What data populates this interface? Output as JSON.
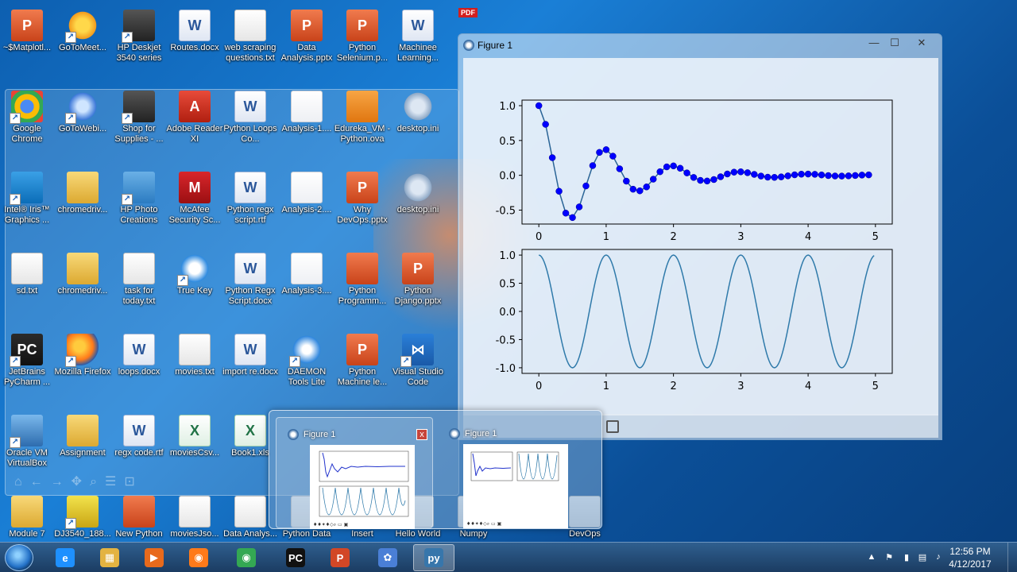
{
  "desktop": {
    "icons": [
      {
        "label": "~$Matplotl...",
        "type": "ppt",
        "glyph": "P"
      },
      {
        "label": "GoToMeet...",
        "type": "flower",
        "glyph": ""
      },
      {
        "label": "HP Deskjet 3540 series",
        "type": "printer",
        "glyph": ""
      },
      {
        "label": "Routes.docx",
        "type": "word",
        "glyph": "W"
      },
      {
        "label": "web scraping questions.txt",
        "type": "txt",
        "glyph": ""
      },
      {
        "label": "Data Analysis.pptx",
        "type": "ppt",
        "glyph": "P"
      },
      {
        "label": "Python Selenium.p...",
        "type": "ppt",
        "glyph": "P"
      },
      {
        "label": "Machinee Learning...",
        "type": "word",
        "glyph": "W"
      },
      {
        "label": "Google Chrome",
        "type": "chrome",
        "glyph": ""
      },
      {
        "label": "GoToWebi...",
        "type": "flower-blue",
        "glyph": ""
      },
      {
        "label": "Shop for Supplies - ...",
        "type": "printer",
        "glyph": ""
      },
      {
        "label": "Adobe Reader XI",
        "type": "pdf",
        "glyph": "A"
      },
      {
        "label": "Python Loops Co...",
        "type": "word",
        "glyph": "W"
      },
      {
        "label": "Analysis-1....",
        "type": "chart",
        "glyph": ""
      },
      {
        "label": "Edureka_VM - Python.ova",
        "type": "ova",
        "glyph": ""
      },
      {
        "label": "desktop.ini",
        "type": "gear",
        "glyph": ""
      },
      {
        "label": "Intel® Iris™ Graphics ...",
        "type": "intel",
        "glyph": ""
      },
      {
        "label": "chromedriv...",
        "type": "folder",
        "glyph": ""
      },
      {
        "label": "HP Photo Creations",
        "type": "photo",
        "glyph": ""
      },
      {
        "label": "McAfee Security Sc...",
        "type": "mcafee",
        "glyph": "M"
      },
      {
        "label": "Python regx script.rtf",
        "type": "word",
        "glyph": "W"
      },
      {
        "label": "Analysis-2....",
        "type": "chart",
        "glyph": ""
      },
      {
        "label": "Why DevOps.pptx",
        "type": "ppt",
        "glyph": "P"
      },
      {
        "label": "desktop.ini",
        "type": "gear",
        "glyph": ""
      },
      {
        "label": "sd.txt",
        "type": "txt",
        "glyph": ""
      },
      {
        "label": "chromedriv...",
        "type": "folder",
        "glyph": ""
      },
      {
        "label": "task for today.txt",
        "type": "txt",
        "glyph": ""
      },
      {
        "label": "True Key",
        "type": "truekey",
        "glyph": ""
      },
      {
        "label": "Python Regx Script.docx",
        "type": "word",
        "glyph": "W"
      },
      {
        "label": "Analysis-3....",
        "type": "chart",
        "glyph": ""
      },
      {
        "label": "Python Programm...",
        "type": "ppt",
        "glyph": ""
      },
      {
        "label": "Python Django.pptx",
        "type": "ppt",
        "glyph": "P"
      },
      {
        "label": "JetBrains PyCharm ...",
        "type": "pc",
        "glyph": "PC"
      },
      {
        "label": "Mozilla Firefox",
        "type": "firefox",
        "glyph": ""
      },
      {
        "label": "loops.docx",
        "type": "word",
        "glyph": "W"
      },
      {
        "label": "movies.txt",
        "type": "txt",
        "glyph": ""
      },
      {
        "label": "import re.docx",
        "type": "word",
        "glyph": "W"
      },
      {
        "label": "DAEMON Tools Lite",
        "type": "daemon",
        "glyph": ""
      },
      {
        "label": "Python Machine le...",
        "type": "ppt",
        "glyph": "P"
      },
      {
        "label": "Visual Studio Code",
        "type": "vs",
        "glyph": "⋈"
      },
      {
        "label": "Oracle VM VirtualBox",
        "type": "vbox",
        "glyph": ""
      },
      {
        "label": "Assignment",
        "type": "folder",
        "glyph": ""
      },
      {
        "label": "regx code.rtf",
        "type": "word",
        "glyph": "W"
      },
      {
        "label": "moviesCsv...",
        "type": "excel",
        "glyph": "X"
      },
      {
        "label": "Book1.xls",
        "type": "excel",
        "glyph": "X"
      },
      {
        "label": "Module 7",
        "type": "folder",
        "glyph": ""
      },
      {
        "label": "DJ3540_188...",
        "type": "usb",
        "glyph": ""
      },
      {
        "label": "New Python",
        "type": "ppt",
        "glyph": ""
      },
      {
        "label": "moviesJso...",
        "type": "txt",
        "glyph": ""
      },
      {
        "label": "Data Analys...",
        "type": "txt",
        "glyph": ""
      },
      {
        "label": "Python Data",
        "type": "txt",
        "glyph": ""
      },
      {
        "label": "Insert",
        "type": "txt",
        "glyph": ""
      },
      {
        "label": "Hello World",
        "type": "txt",
        "glyph": ""
      },
      {
        "label": "Numpy",
        "type": "txt",
        "glyph": ""
      },
      {
        "label": "DevOps",
        "type": "txt",
        "glyph": ""
      }
    ],
    "pdf_badge": "PDF"
  },
  "figure_window": {
    "title": "Figure 1",
    "minimize": "—",
    "maximize": "☐",
    "close": "✕"
  },
  "chart_data": [
    {
      "type": "line",
      "title": "",
      "xlabel": "",
      "ylabel": "",
      "xlim": [
        -0.25,
        5.25
      ],
      "ylim": [
        -0.7,
        1.08
      ],
      "xticks": [
        "0",
        "1",
        "2",
        "3",
        "4",
        "5"
      ],
      "yticks": [
        "-0.5",
        "0.0",
        "0.5",
        "1.0"
      ],
      "marker": "circle",
      "line_color": "#2a6496",
      "marker_color": "#0000ff",
      "function": "exp(-t)*cos(2*pi*t)",
      "x": [
        0.0,
        0.1,
        0.2,
        0.3,
        0.4,
        0.5,
        0.6,
        0.7,
        0.8,
        0.9,
        1.0,
        1.1,
        1.2,
        1.3,
        1.4,
        1.5,
        1.6,
        1.7,
        1.8,
        1.9,
        2.0,
        2.1,
        2.2,
        2.3,
        2.4,
        2.5,
        2.6,
        2.7,
        2.8,
        2.9,
        3.0,
        3.1,
        3.2,
        3.3,
        3.4,
        3.5,
        3.6,
        3.7,
        3.8,
        3.9,
        4.0,
        4.1,
        4.2,
        4.3,
        4.4,
        4.5,
        4.6,
        4.7,
        4.8,
        4.9
      ],
      "y": [
        1.0,
        0.732,
        0.253,
        -0.229,
        -0.543,
        -0.607,
        -0.454,
        -0.153,
        0.139,
        0.329,
        0.368,
        0.275,
        0.093,
        -0.084,
        -0.2,
        -0.223,
        -0.167,
        -0.056,
        0.051,
        0.121,
        0.135,
        0.101,
        0.034,
        -0.031,
        -0.073,
        -0.082,
        -0.061,
        -0.021,
        0.019,
        0.045,
        0.05,
        0.037,
        0.013,
        -0.011,
        -0.027,
        -0.03,
        -0.023,
        -0.008,
        0.007,
        0.016,
        0.018,
        0.014,
        0.005,
        -0.004,
        -0.01,
        -0.011,
        -0.008,
        -0.003,
        0.003,
        0.006
      ]
    },
    {
      "type": "line",
      "title": "",
      "xlabel": "",
      "ylabel": "",
      "xlim": [
        -0.25,
        5.25
      ],
      "ylim": [
        -1.1,
        1.1
      ],
      "xticks": [
        "0",
        "1",
        "2",
        "3",
        "4",
        "5"
      ],
      "yticks": [
        "-1.0",
        "-0.5",
        "0.0",
        "0.5",
        "1.0"
      ],
      "line_color": "#2f7aaa",
      "function": "cos(2*pi*t)",
      "x_range": [
        0.0,
        4.98
      ],
      "x_step": 0.02
    }
  ],
  "thumbnails": [
    {
      "title": "Figure 1",
      "close": "x"
    },
    {
      "title": "Figure 1"
    }
  ],
  "taskbar": {
    "apps": [
      {
        "name": "internet-explorer",
        "glyph": "e",
        "color": "#1e90ff"
      },
      {
        "name": "file-explorer",
        "glyph": "▦",
        "color": "#e3b341"
      },
      {
        "name": "media-player",
        "glyph": "▶",
        "color": "#e86a1c"
      },
      {
        "name": "firefox",
        "glyph": "◉",
        "color": "#ff7a1a"
      },
      {
        "name": "chrome",
        "glyph": "◉",
        "color": "#34a853"
      },
      {
        "name": "pycharm",
        "glyph": "PC",
        "color": "#111111"
      },
      {
        "name": "powerpoint",
        "glyph": "P",
        "color": "#d24726"
      },
      {
        "name": "gotomeeting",
        "glyph": "✿",
        "color": "#4a7fd6"
      },
      {
        "name": "python",
        "glyph": "py",
        "color": "#3776ab"
      }
    ],
    "clock_time": "12:56 PM",
    "clock_date": "4/12/2017"
  }
}
